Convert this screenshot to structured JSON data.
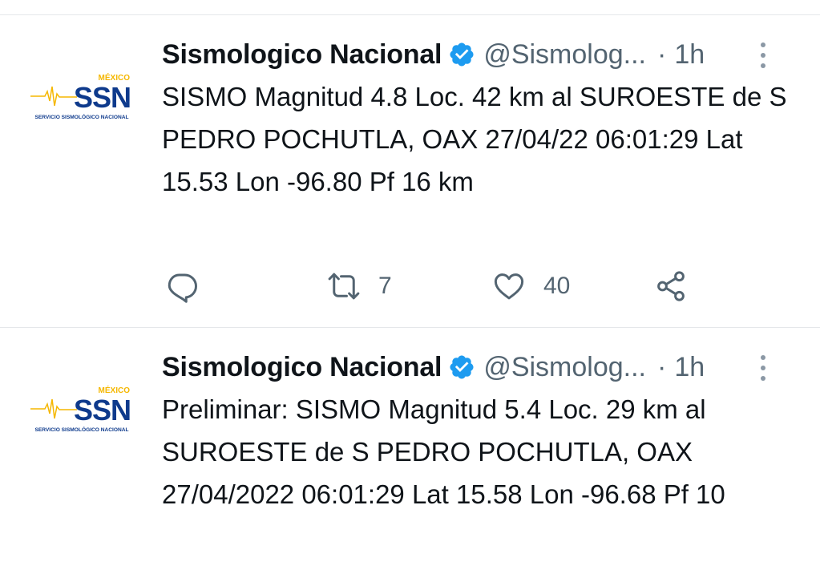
{
  "colors": {
    "text": "#0f1419",
    "secondary": "#536471",
    "verified": "#1d9bf0",
    "divider": "#e5e7ea",
    "logo_blue": "#0e3a8c",
    "logo_yellow": "#f5b700"
  },
  "tweets": [
    {
      "avatar": {
        "logo": "SSN",
        "country": "MÉXICO",
        "subtitle": "SERVICIO SISMOLÓGICO NACIONAL"
      },
      "name": "Sismologico Nacional",
      "handle": "@Sismolog...",
      "separator": "·",
      "time": "1h",
      "text": "SISMO Magnitud 4.8 Loc. 42 km al SUROESTE de S PEDRO POCHUTLA, OAX 27/04/22 06:01:29 Lat 15.53 Lon -96.80 Pf 16 km",
      "retweets": "7",
      "likes": "40",
      "icons": [
        "verified-icon",
        "more-icon",
        "reply-icon",
        "retweet-icon",
        "like-icon",
        "share-icon"
      ]
    },
    {
      "avatar": {
        "logo": "SSN",
        "country": "MÉXICO",
        "subtitle": "SERVICIO SISMOLÓGICO NACIONAL"
      },
      "name": "Sismologico Nacional",
      "handle": "@Sismolog...",
      "separator": "·",
      "time": "1h",
      "text": "Preliminar: SISMO Magnitud 5.4 Loc. 29 km al SUROESTE de S PEDRO POCHUTLA, OAX 27/04/2022 06:01:29 Lat 15.58 Lon -96.68 Pf 10",
      "icons": [
        "verified-icon",
        "more-icon"
      ]
    }
  ]
}
